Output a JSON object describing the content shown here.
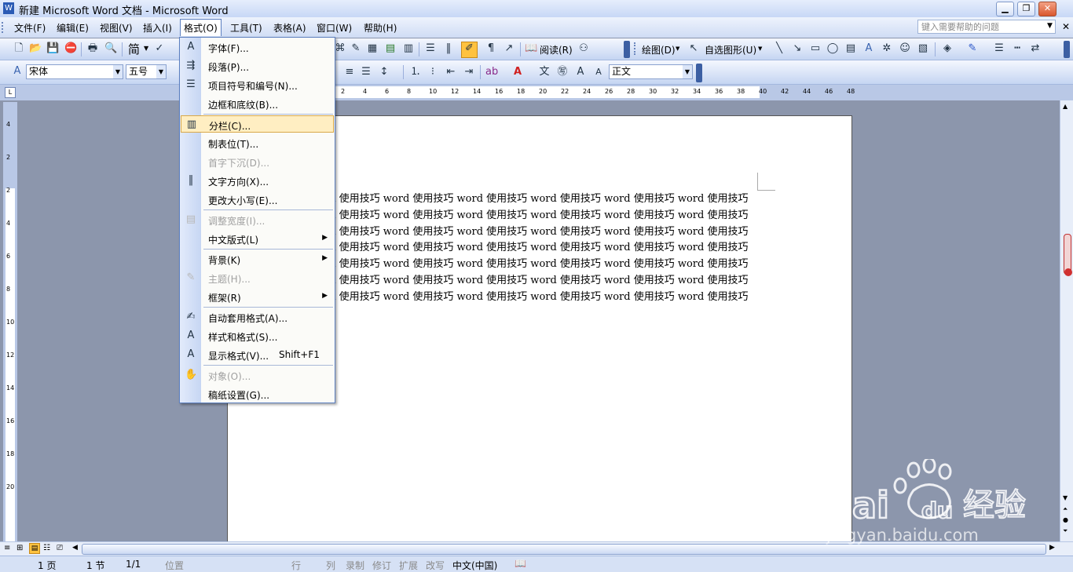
{
  "window": {
    "title": "新建 Microsoft Word 文档 - Microsoft Word"
  },
  "menubar": {
    "items": [
      "文件(F)",
      "编辑(E)",
      "视图(V)",
      "插入(I)",
      "格式(O)",
      "工具(T)",
      "表格(A)",
      "窗口(W)",
      "帮助(H)"
    ],
    "help_placeholder": "键入需要帮助的问题"
  },
  "toolbar1": {
    "simplified_label": "简",
    "reading_label": "阅读(R)",
    "draw_label": "绘图(D)",
    "autoshape_label": "自选图形(U)"
  },
  "toolbar2": {
    "font_name": "宋体",
    "font_size": "五号",
    "style_name": "正文"
  },
  "ruler": {
    "h_numbers": [
      "2",
      "4",
      "6",
      "8",
      "10",
      "12",
      "14",
      "16",
      "18",
      "20",
      "22",
      "24",
      "26",
      "28",
      "30",
      "32",
      "34",
      "36",
      "38",
      "40",
      "42",
      "44",
      "46",
      "48"
    ],
    "v_numbers": [
      "4",
      "2",
      "2",
      "4",
      "6",
      "8",
      "10",
      "12",
      "14",
      "16",
      "18",
      "20"
    ]
  },
  "document": {
    "lines": [
      "rd 使用技巧 word 使用技巧 word 使用技巧 word 使用技巧 word 使用技巧 word 使用技巧",
      "rd 使用技巧 word 使用技巧 word 使用技巧 word 使用技巧 word 使用技巧 word 使用技巧",
      "rd 使用技巧 word 使用技巧 word 使用技巧 word 使用技巧 word 使用技巧 word 使用技巧",
      "rd 使用技巧 word 使用技巧 word 使用技巧 word 使用技巧 word 使用技巧 word 使用技巧",
      "rd 使用技巧 word 使用技巧 word 使用技巧 word 使用技巧 word 使用技巧 word 使用技巧",
      "rd 使用技巧 word 使用技巧 word 使用技巧 word 使用技巧 word 使用技巧 word 使用技巧",
      "rd 使用技巧 word 使用技巧 word 使用技巧 word 使用技巧 word 使用技巧 word 使用技巧"
    ]
  },
  "format_menu": {
    "items": [
      {
        "label": "字体(F)...",
        "icon": "font-icon"
      },
      {
        "label": "段落(P)...",
        "icon": "paragraph-icon"
      },
      {
        "label": "项目符号和编号(N)...",
        "icon": "bullets-icon"
      },
      {
        "label": "边框和底纹(B)...",
        "icon": ""
      },
      {
        "label": "分栏(C)...",
        "icon": "columns-icon",
        "highlighted": true
      },
      {
        "label": "制表位(T)...",
        "icon": ""
      },
      {
        "label": "首字下沉(D)...",
        "icon": "",
        "disabled": true
      },
      {
        "label": "文字方向(X)...",
        "icon": "text-direction-icon"
      },
      {
        "label": "更改大小写(E)...",
        "icon": ""
      },
      {
        "label": "调整宽度(I)...",
        "icon": "fit-width-icon",
        "disabled": true
      },
      {
        "label": "中文版式(L)",
        "icon": "",
        "submenu": true
      },
      {
        "label": "背景(K)",
        "icon": "",
        "submenu": true
      },
      {
        "label": "主题(H)...",
        "icon": "theme-icon",
        "disabled": true
      },
      {
        "label": "框架(R)",
        "icon": "",
        "submenu": true
      },
      {
        "label": "自动套用格式(A)...",
        "icon": "autoformat-icon"
      },
      {
        "label": "样式和格式(S)...",
        "icon": "styles-icon"
      },
      {
        "label": "显示格式(V)...",
        "icon": "reveal-format-icon",
        "shortcut": "Shift+F1"
      },
      {
        "label": "对象(O)...",
        "icon": "object-icon",
        "disabled": true
      },
      {
        "label": "稿纸设置(G)...",
        "icon": ""
      }
    ]
  },
  "statusbar": {
    "page": "1 页",
    "section": "1 节",
    "pages": "1/1",
    "position": "位置",
    "line": "行",
    "column": "列",
    "record": "录制",
    "revise": "修订",
    "extend": "扩展",
    "overtype": "改写",
    "language": "中文(中国)"
  },
  "watermark": {
    "brand": "Baidu经验",
    "url": "jingyan.baidu.com"
  }
}
